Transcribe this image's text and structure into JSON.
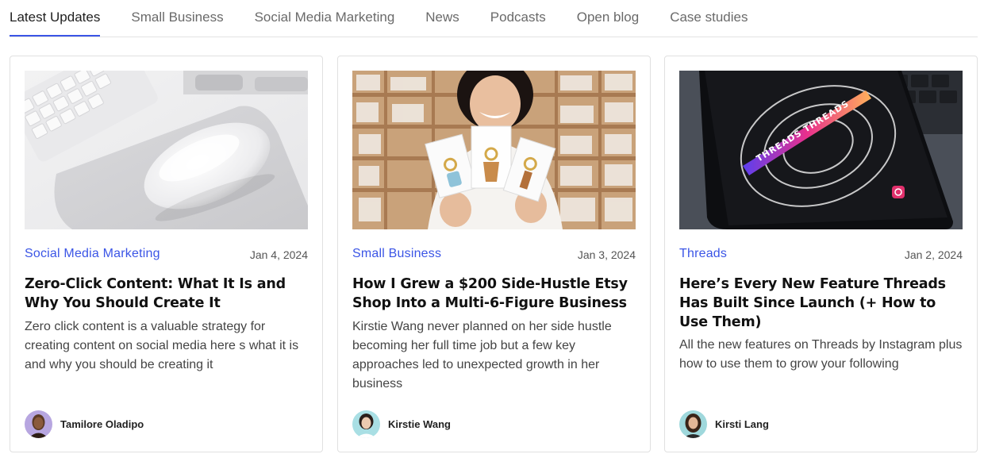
{
  "tabs": [
    {
      "label": "Latest Updates",
      "active": true
    },
    {
      "label": "Small Business"
    },
    {
      "label": "Social Media Marketing"
    },
    {
      "label": "News"
    },
    {
      "label": "Podcasts"
    },
    {
      "label": "Open blog"
    },
    {
      "label": "Case studies"
    }
  ],
  "accent_color": "#3b55e6",
  "cards": [
    {
      "image": "mouse-on-desk-photo",
      "category": "Social Media Marketing",
      "date": "Jan 4, 2024",
      "title": "Zero-Click Content: What It Is and Why You Should Create It",
      "excerpt": "Zero click content is a valuable strategy for creating content on social media here s what it is and why you should be creating it",
      "author": "Tamilore Oladipo"
    },
    {
      "image": "woman-holding-keychains-photo",
      "category": "Small Business",
      "date": "Jan 3, 2024",
      "title": "How I Grew a $200 Side-Hustle Etsy Shop Into a Multi-6-Figure Business",
      "excerpt": "Kirstie Wang never planned on her side hustle becoming her full time job but a few key approaches led to unexpected growth in her business",
      "author": "Kirstie Wang"
    },
    {
      "image": "threads-phone-photo",
      "category": "Threads",
      "date": "Jan 2, 2024",
      "title": "Here’s Every New Feature Threads Has Built Since Launch (+ How to Use Them)",
      "excerpt": "All the new features on Threads by Instagram plus how to use them to grow your following",
      "author": "Kirsti Lang"
    }
  ]
}
